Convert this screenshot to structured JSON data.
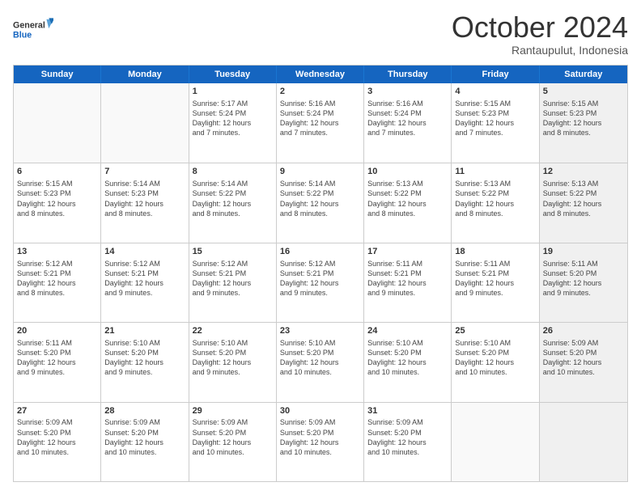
{
  "logo": {
    "line1": "General",
    "line2": "Blue"
  },
  "title": "October 2024",
  "location": "Rantaupulut, Indonesia",
  "weekdays": [
    "Sunday",
    "Monday",
    "Tuesday",
    "Wednesday",
    "Thursday",
    "Friday",
    "Saturday"
  ],
  "rows": [
    [
      {
        "day": "",
        "sunrise": "",
        "sunset": "",
        "daylight": "",
        "empty": true
      },
      {
        "day": "",
        "sunrise": "",
        "sunset": "",
        "daylight": "",
        "empty": true
      },
      {
        "day": "1",
        "sunrise": "Sunrise: 5:17 AM",
        "sunset": "Sunset: 5:24 PM",
        "daylight": "Daylight: 12 hours",
        "daylight2": "and 7 minutes.",
        "empty": false
      },
      {
        "day": "2",
        "sunrise": "Sunrise: 5:16 AM",
        "sunset": "Sunset: 5:24 PM",
        "daylight": "Daylight: 12 hours",
        "daylight2": "and 7 minutes.",
        "empty": false
      },
      {
        "day": "3",
        "sunrise": "Sunrise: 5:16 AM",
        "sunset": "Sunset: 5:24 PM",
        "daylight": "Daylight: 12 hours",
        "daylight2": "and 7 minutes.",
        "empty": false
      },
      {
        "day": "4",
        "sunrise": "Sunrise: 5:15 AM",
        "sunset": "Sunset: 5:23 PM",
        "daylight": "Daylight: 12 hours",
        "daylight2": "and 7 minutes.",
        "empty": false
      },
      {
        "day": "5",
        "sunrise": "Sunrise: 5:15 AM",
        "sunset": "Sunset: 5:23 PM",
        "daylight": "Daylight: 12 hours",
        "daylight2": "and 8 minutes.",
        "empty": false,
        "shaded": true
      }
    ],
    [
      {
        "day": "6",
        "sunrise": "Sunrise: 5:15 AM",
        "sunset": "Sunset: 5:23 PM",
        "daylight": "Daylight: 12 hours",
        "daylight2": "and 8 minutes.",
        "empty": false
      },
      {
        "day": "7",
        "sunrise": "Sunrise: 5:14 AM",
        "sunset": "Sunset: 5:23 PM",
        "daylight": "Daylight: 12 hours",
        "daylight2": "and 8 minutes.",
        "empty": false
      },
      {
        "day": "8",
        "sunrise": "Sunrise: 5:14 AM",
        "sunset": "Sunset: 5:22 PM",
        "daylight": "Daylight: 12 hours",
        "daylight2": "and 8 minutes.",
        "empty": false
      },
      {
        "day": "9",
        "sunrise": "Sunrise: 5:14 AM",
        "sunset": "Sunset: 5:22 PM",
        "daylight": "Daylight: 12 hours",
        "daylight2": "and 8 minutes.",
        "empty": false
      },
      {
        "day": "10",
        "sunrise": "Sunrise: 5:13 AM",
        "sunset": "Sunset: 5:22 PM",
        "daylight": "Daylight: 12 hours",
        "daylight2": "and 8 minutes.",
        "empty": false
      },
      {
        "day": "11",
        "sunrise": "Sunrise: 5:13 AM",
        "sunset": "Sunset: 5:22 PM",
        "daylight": "Daylight: 12 hours",
        "daylight2": "and 8 minutes.",
        "empty": false
      },
      {
        "day": "12",
        "sunrise": "Sunrise: 5:13 AM",
        "sunset": "Sunset: 5:22 PM",
        "daylight": "Daylight: 12 hours",
        "daylight2": "and 8 minutes.",
        "empty": false,
        "shaded": true
      }
    ],
    [
      {
        "day": "13",
        "sunrise": "Sunrise: 5:12 AM",
        "sunset": "Sunset: 5:21 PM",
        "daylight": "Daylight: 12 hours",
        "daylight2": "and 8 minutes.",
        "empty": false
      },
      {
        "day": "14",
        "sunrise": "Sunrise: 5:12 AM",
        "sunset": "Sunset: 5:21 PM",
        "daylight": "Daylight: 12 hours",
        "daylight2": "and 9 minutes.",
        "empty": false
      },
      {
        "day": "15",
        "sunrise": "Sunrise: 5:12 AM",
        "sunset": "Sunset: 5:21 PM",
        "daylight": "Daylight: 12 hours",
        "daylight2": "and 9 minutes.",
        "empty": false
      },
      {
        "day": "16",
        "sunrise": "Sunrise: 5:12 AM",
        "sunset": "Sunset: 5:21 PM",
        "daylight": "Daylight: 12 hours",
        "daylight2": "and 9 minutes.",
        "empty": false
      },
      {
        "day": "17",
        "sunrise": "Sunrise: 5:11 AM",
        "sunset": "Sunset: 5:21 PM",
        "daylight": "Daylight: 12 hours",
        "daylight2": "and 9 minutes.",
        "empty": false
      },
      {
        "day": "18",
        "sunrise": "Sunrise: 5:11 AM",
        "sunset": "Sunset: 5:21 PM",
        "daylight": "Daylight: 12 hours",
        "daylight2": "and 9 minutes.",
        "empty": false
      },
      {
        "day": "19",
        "sunrise": "Sunrise: 5:11 AM",
        "sunset": "Sunset: 5:20 PM",
        "daylight": "Daylight: 12 hours",
        "daylight2": "and 9 minutes.",
        "empty": false,
        "shaded": true
      }
    ],
    [
      {
        "day": "20",
        "sunrise": "Sunrise: 5:11 AM",
        "sunset": "Sunset: 5:20 PM",
        "daylight": "Daylight: 12 hours",
        "daylight2": "and 9 minutes.",
        "empty": false
      },
      {
        "day": "21",
        "sunrise": "Sunrise: 5:10 AM",
        "sunset": "Sunset: 5:20 PM",
        "daylight": "Daylight: 12 hours",
        "daylight2": "and 9 minutes.",
        "empty": false
      },
      {
        "day": "22",
        "sunrise": "Sunrise: 5:10 AM",
        "sunset": "Sunset: 5:20 PM",
        "daylight": "Daylight: 12 hours",
        "daylight2": "and 9 minutes.",
        "empty": false
      },
      {
        "day": "23",
        "sunrise": "Sunrise: 5:10 AM",
        "sunset": "Sunset: 5:20 PM",
        "daylight": "Daylight: 12 hours",
        "daylight2": "and 10 minutes.",
        "empty": false
      },
      {
        "day": "24",
        "sunrise": "Sunrise: 5:10 AM",
        "sunset": "Sunset: 5:20 PM",
        "daylight": "Daylight: 12 hours",
        "daylight2": "and 10 minutes.",
        "empty": false
      },
      {
        "day": "25",
        "sunrise": "Sunrise: 5:10 AM",
        "sunset": "Sunset: 5:20 PM",
        "daylight": "Daylight: 12 hours",
        "daylight2": "and 10 minutes.",
        "empty": false
      },
      {
        "day": "26",
        "sunrise": "Sunrise: 5:09 AM",
        "sunset": "Sunset: 5:20 PM",
        "daylight": "Daylight: 12 hours",
        "daylight2": "and 10 minutes.",
        "empty": false,
        "shaded": true
      }
    ],
    [
      {
        "day": "27",
        "sunrise": "Sunrise: 5:09 AM",
        "sunset": "Sunset: 5:20 PM",
        "daylight": "Daylight: 12 hours",
        "daylight2": "and 10 minutes.",
        "empty": false
      },
      {
        "day": "28",
        "sunrise": "Sunrise: 5:09 AM",
        "sunset": "Sunset: 5:20 PM",
        "daylight": "Daylight: 12 hours",
        "daylight2": "and 10 minutes.",
        "empty": false
      },
      {
        "day": "29",
        "sunrise": "Sunrise: 5:09 AM",
        "sunset": "Sunset: 5:20 PM",
        "daylight": "Daylight: 12 hours",
        "daylight2": "and 10 minutes.",
        "empty": false
      },
      {
        "day": "30",
        "sunrise": "Sunrise: 5:09 AM",
        "sunset": "Sunset: 5:20 PM",
        "daylight": "Daylight: 12 hours",
        "daylight2": "and 10 minutes.",
        "empty": false
      },
      {
        "day": "31",
        "sunrise": "Sunrise: 5:09 AM",
        "sunset": "Sunset: 5:20 PM",
        "daylight": "Daylight: 12 hours",
        "daylight2": "and 10 minutes.",
        "empty": false
      },
      {
        "day": "",
        "sunrise": "",
        "sunset": "",
        "daylight": "",
        "daylight2": "",
        "empty": true
      },
      {
        "day": "",
        "sunrise": "",
        "sunset": "",
        "daylight": "",
        "daylight2": "",
        "empty": true,
        "shaded": true
      }
    ]
  ]
}
